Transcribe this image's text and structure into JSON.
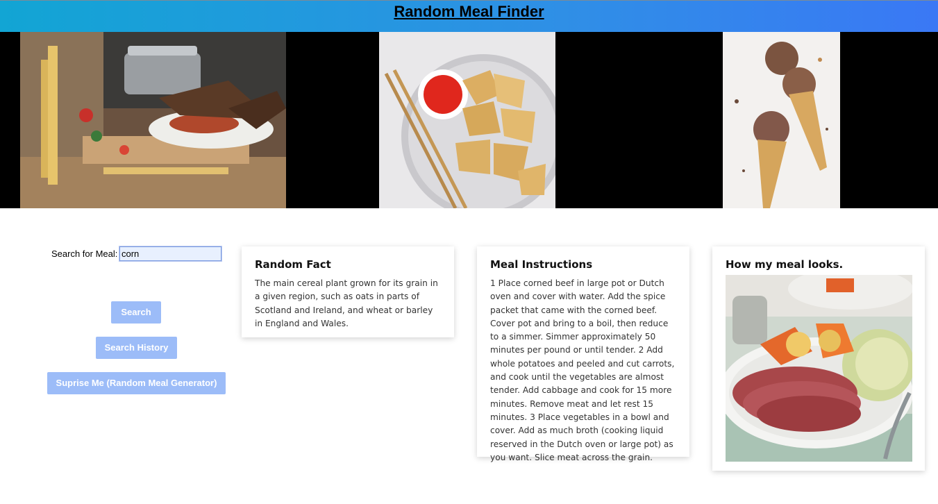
{
  "header": {
    "title": "Random Meal Finder"
  },
  "banner": {
    "photos": [
      {
        "icon": "pasta-kitchen-photo"
      },
      {
        "icon": "wontons-bowl-photo"
      },
      {
        "icon": "ice-cream-cones-photo"
      }
    ]
  },
  "search": {
    "label": "Search for Meal:",
    "value": "corn",
    "placeholder": ""
  },
  "buttons": {
    "search": "Search",
    "history": "Search History",
    "surprise": "Suprise Me (Random Meal Generator)"
  },
  "fact_card": {
    "title": "Random Fact",
    "text": "The main cereal plant grown for its grain in a given region, such as oats in parts of Scotland and Ireland, and wheat or barley in England and Wales."
  },
  "instructions_card": {
    "title": "Meal Instructions",
    "text": "1 Place corned beef in large pot or Dutch oven and cover with water. Add the spice packet that came with the corned beef. Cover pot and bring to a boil, then reduce to a simmer. Simmer approximately 50 minutes per pound or until tender. 2 Add whole potatoes and peeled and cut carrots, and cook until the vegetables are almost tender. Add cabbage and cook for 15 more minutes. Remove meat and let rest 15 minutes. 3 Place vegetables in a bowl and cover. Add as much broth (cooking liquid reserved in the Dutch oven or large pot) as you want. Slice meat across the grain."
  },
  "look_card": {
    "title": "How my meal looks.",
    "image_icon": "corned-beef-cabbage-photo"
  },
  "colors": {
    "header_start": "#12a5d4",
    "header_end": "#3a78f5",
    "button": "#9cbcf8",
    "input_bg": "#e8f0fe"
  }
}
